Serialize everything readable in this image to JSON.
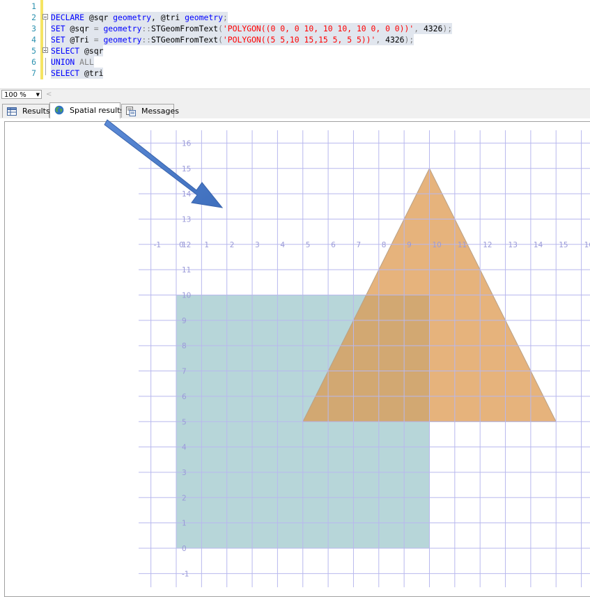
{
  "editor": {
    "lines": [
      {
        "num": "1",
        "tokens": []
      },
      {
        "num": "2",
        "tokens": [
          {
            "t": "DECLARE",
            "c": "kw"
          },
          {
            "t": " @sqr ",
            "c": "tx"
          },
          {
            "t": "geometry",
            "c": "kw"
          },
          {
            "t": ", @tri ",
            "c": "tx"
          },
          {
            "t": "geometry",
            "c": "kw"
          },
          {
            "t": ";",
            "c": "gr"
          }
        ]
      },
      {
        "num": "3",
        "tokens": [
          {
            "t": "SET",
            "c": "kw"
          },
          {
            "t": " @sqr ",
            "c": "tx"
          },
          {
            "t": "=",
            "c": "gr"
          },
          {
            "t": " ",
            "c": "tx"
          },
          {
            "t": "geometry",
            "c": "kw"
          },
          {
            "t": "::",
            "c": "gr"
          },
          {
            "t": "STGeomFromText",
            "c": "tx"
          },
          {
            "t": "(",
            "c": "gr"
          },
          {
            "t": "'POLYGON((0 0, 0 10, 10 10, 10 0, 0 0))'",
            "c": "str"
          },
          {
            "t": ",",
            "c": "gr"
          },
          {
            "t": " 4326",
            "c": "tx"
          },
          {
            "t": ");",
            "c": "gr"
          }
        ]
      },
      {
        "num": "4",
        "tokens": [
          {
            "t": "SET",
            "c": "kw"
          },
          {
            "t": " @Tri ",
            "c": "tx"
          },
          {
            "t": "=",
            "c": "gr"
          },
          {
            "t": " ",
            "c": "tx"
          },
          {
            "t": "geometry",
            "c": "kw"
          },
          {
            "t": "::",
            "c": "gr"
          },
          {
            "t": "STGeomFromText",
            "c": "tx"
          },
          {
            "t": "(",
            "c": "gr"
          },
          {
            "t": "'POLYGON((5 5,10 15,15 5, 5 5))'",
            "c": "str"
          },
          {
            "t": ",",
            "c": "gr"
          },
          {
            "t": " 4326",
            "c": "tx"
          },
          {
            "t": ");",
            "c": "gr"
          }
        ]
      },
      {
        "num": "5",
        "tokens": [
          {
            "t": "SELECT",
            "c": "kw"
          },
          {
            "t": " @sqr",
            "c": "tx"
          }
        ]
      },
      {
        "num": "6",
        "tokens": [
          {
            "t": "UNION",
            "c": "kw"
          },
          {
            "t": " ",
            "c": "tx"
          },
          {
            "t": "ALL",
            "c": "gr"
          }
        ]
      },
      {
        "num": "7",
        "tokens": [
          {
            "t": "SELECT",
            "c": "kw"
          },
          {
            "t": " @tri",
            "c": "tx"
          }
        ]
      }
    ]
  },
  "zoom": {
    "value": "100 %"
  },
  "tabs": [
    {
      "label": "Results",
      "icon": "grid-icon",
      "active": false
    },
    {
      "label": "Spatial results",
      "icon": "globe-icon",
      "active": true
    },
    {
      "label": "Messages",
      "icon": "messages-icon",
      "active": false
    }
  ],
  "spatial": {
    "x_ticks": [
      "-1",
      "0",
      "1",
      "2",
      "3",
      "4",
      "5",
      "6",
      "7",
      "8",
      "9",
      "10",
      "11",
      "12",
      "13",
      "14",
      "15",
      "16"
    ],
    "y_ticks": [
      "16",
      "15",
      "14",
      "13",
      "12",
      "11",
      "10",
      "9",
      "8",
      "7",
      "6",
      "5",
      "4",
      "3",
      "2",
      "1",
      "0",
      "-1"
    ],
    "x_range": [
      -1,
      16
    ],
    "y_range": [
      -1,
      16
    ],
    "shapes": [
      {
        "name": "sqr",
        "points": [
          [
            0,
            0
          ],
          [
            0,
            10
          ],
          [
            10,
            10
          ],
          [
            10,
            0
          ],
          [
            0,
            0
          ]
        ],
        "fill": "#b7d6d9",
        "stroke": "#9db8c6"
      },
      {
        "name": "tri",
        "points": [
          [
            5,
            5
          ],
          [
            10,
            15
          ],
          [
            15,
            5
          ],
          [
            5,
            5
          ]
        ],
        "fill": "#dc9649",
        "stroke": "#b8a188",
        "opacity": 0.72
      }
    ],
    "colors": {
      "grid": "#b8b8ee",
      "tick_text": "#9a9ad8",
      "arrow": "#4f7fc9"
    }
  }
}
